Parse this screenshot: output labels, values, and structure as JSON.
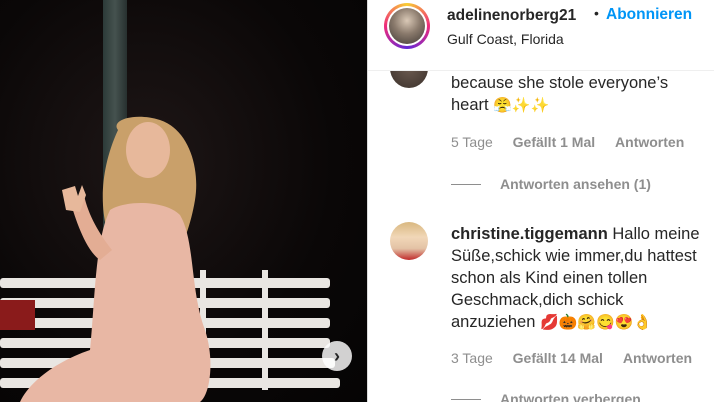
{
  "post": {
    "username": "adelinenorberg21",
    "dot": "•",
    "follow_label": "Abonnieren",
    "location": "Gulf Coast, Florida",
    "next_icon": "›"
  },
  "comments": [
    {
      "text_line1": "because she stole everyone’s",
      "text_line2": "heart",
      "emojis": "😤✨✨",
      "age": "5 Tage",
      "likes": "Gefällt 1 Mal",
      "reply_label": "Antworten",
      "view_replies": "Antworten ansehen (1)"
    },
    {
      "username": "christine.tiggemann",
      "line1_rest": "Hallo meine",
      "line2": "Süße,schick wie immer,du hattest",
      "line3": "schon als Kind einen tollen",
      "line4": "Geschmack,dich schick",
      "line5": "anzuziehen",
      "emojis": "💋🎃🤗😋😍👌",
      "age": "3 Tage",
      "likes": "Gefällt 14 Mal",
      "reply_label": "Antworten",
      "hide_replies": "Antworten verbergen"
    }
  ],
  "colors": {
    "accent": "#0095f6",
    "text": "#262626",
    "muted": "#8e8e8e"
  }
}
